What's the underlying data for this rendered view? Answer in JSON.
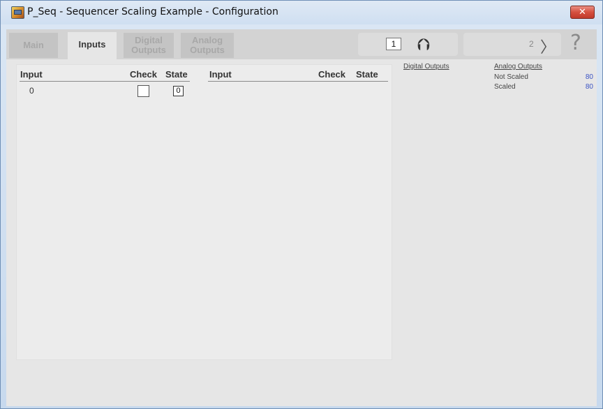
{
  "window": {
    "title": "P_Seq - Sequencer Scaling Example - Configuration",
    "close_glyph": "✕"
  },
  "tabs": [
    {
      "label": "Main",
      "active": false
    },
    {
      "label": "Inputs",
      "active": true
    },
    {
      "line1": "Digital",
      "line2": "Outputs",
      "active": false
    },
    {
      "line1": "Analog",
      "line2": "Outputs",
      "active": false
    }
  ],
  "nav": {
    "page": "1",
    "up_icon": "up-arrow-icon",
    "up_glyph": "⮉",
    "next_page": "2",
    "next_glyph": "〉",
    "help_glyph": "?"
  },
  "inputs_table": {
    "left": {
      "input": "Input",
      "check": "Check",
      "state": "State"
    },
    "right": {
      "input": "Input",
      "check": "Check",
      "state": "State"
    },
    "rows": [
      {
        "input": "0",
        "checked": false,
        "state": "0"
      }
    ]
  },
  "summary": {
    "digital_outputs": "Digital Outputs",
    "analog_outputs": "Analog Outputs",
    "not_scaled_label": "Not Scaled",
    "not_scaled_value": "80",
    "scaled_label": "Scaled",
    "scaled_value": "80"
  },
  "colors": {
    "value_blue": "#3b53c4",
    "close_red": "#d5503f"
  }
}
